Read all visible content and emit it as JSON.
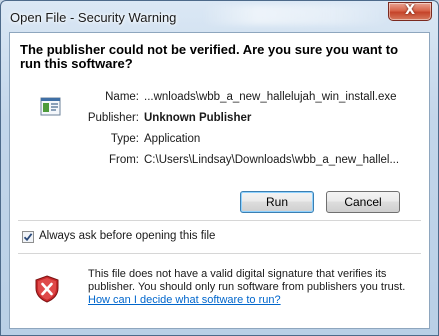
{
  "window": {
    "title": "Open File - Security Warning",
    "close_glyph": "X"
  },
  "heading": "The publisher could not be verified.  Are you sure you want to run this software?",
  "icons": {
    "file": "application-file-icon",
    "shield": "security-shield-x-icon",
    "check": "checkmark-icon"
  },
  "details": {
    "name_label": "Name:",
    "name_value": "...wnloads\\wbb_a_new_hallelujah_win_install.exe",
    "publisher_label": "Publisher:",
    "publisher_value": "Unknown Publisher",
    "type_label": "Type:",
    "type_value": "Application",
    "from_label": "From:",
    "from_value": "C:\\Users\\Lindsay\\Downloads\\wbb_a_new_hallel..."
  },
  "buttons": {
    "run": "Run",
    "cancel": "Cancel"
  },
  "checkbox": {
    "label": "Always ask before opening this file",
    "checked": true
  },
  "warning": {
    "text": "This file does not have a valid digital signature that verifies its publisher.  You should only run software from publishers you trust.",
    "link": "How can I decide what software to run?"
  },
  "colors": {
    "link": "#0066cc",
    "close_button": "#c5442a",
    "shield_red": "#c8282a"
  }
}
